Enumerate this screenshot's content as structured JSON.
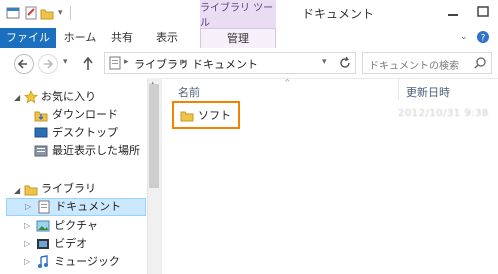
{
  "window": {
    "title": "ドキュメント",
    "context_tab": "ライブラリ ツール"
  },
  "ribbon": {
    "tabs": [
      "ファイル",
      "ホーム",
      "共有",
      "表示",
      "管理"
    ]
  },
  "address": {
    "path": [
      "ライブラリ",
      "ドキュメント"
    ]
  },
  "search": {
    "placeholder": "ドキュメントの検索"
  },
  "nav": {
    "favorites": {
      "label": "お気に入り",
      "items": [
        "ダウンロード",
        "デスクトップ",
        "最近表示した場所"
      ]
    },
    "libraries": {
      "label": "ライブラリ",
      "items": [
        "ドキュメント",
        "ピクチャ",
        "ビデオ",
        "ミュージック"
      ]
    }
  },
  "content": {
    "columns": {
      "name": "名前",
      "modified": "更新日時"
    },
    "files": [
      {
        "name": "ソフト",
        "modified": "2012/10/31 9:38"
      }
    ]
  },
  "colors": {
    "file_tab": "#1a6fbf",
    "selection": "#cce8ff",
    "highlight_border": "#f08300",
    "context_tab": "#eadcf2"
  }
}
